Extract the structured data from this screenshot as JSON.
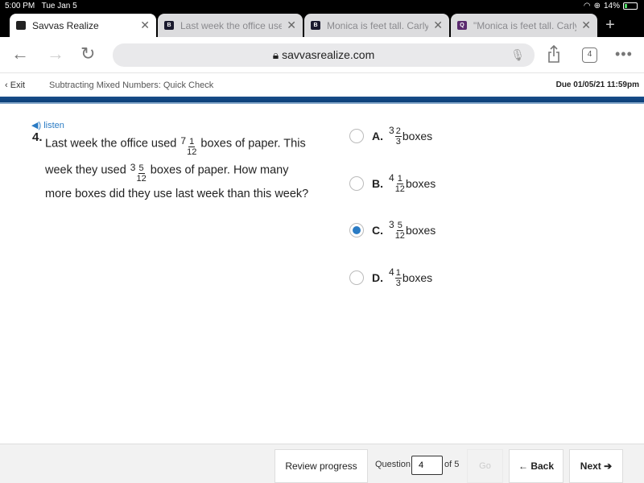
{
  "status_bar": {
    "time": "5:00 PM",
    "date": "Tue Jan 5",
    "battery": "14%"
  },
  "tabs": [
    {
      "title": "Savvas Realize",
      "icon": "savvas-favicon",
      "active": true,
      "favicon_color": "#222222"
    },
    {
      "title": "Last week the office used",
      "icon": "brainly-favicon",
      "active": false,
      "favicon_color": "#1a1a2e"
    },
    {
      "title": "Monica is feet tall. Carly is",
      "icon": "brainly-favicon",
      "active": false,
      "favicon_color": "#1a1a2e"
    },
    {
      "title": "\"Monica is feet tall. Carly",
      "icon": "quizlet-favicon",
      "active": false,
      "favicon_color": "#5a2a6e"
    }
  ],
  "toolbar": {
    "url": "savvasrealize.com",
    "tab_count": "4"
  },
  "app_header": {
    "exit_label": "Exit",
    "breadcrumb": "Subtracting Mixed Numbers: Quick Check",
    "due": "Due 01/05/21 11:59pm"
  },
  "question": {
    "listen_label": "listen",
    "number": "4",
    "text_part1": "Last week the office used",
    "mixed1": {
      "whole": "7",
      "num": "1",
      "den": "12"
    },
    "text_part2": "boxes of paper. This week they used",
    "mixed2": {
      "whole": "3",
      "num": "5",
      "den": "12"
    },
    "text_part3": "boxes of paper. How many more boxes did they use last week than this week?"
  },
  "options": [
    {
      "letter": "A.",
      "whole": "3",
      "num": "2",
      "den": "3",
      "unit": "boxes",
      "selected": false
    },
    {
      "letter": "B.",
      "whole": "4",
      "num": "1",
      "den": "12",
      "unit": "boxes",
      "selected": false
    },
    {
      "letter": "C.",
      "whole": "3",
      "num": "5",
      "den": "12",
      "unit": "boxes",
      "selected": true
    },
    {
      "letter": "D.",
      "whole": "4",
      "num": "1",
      "den": "3",
      "unit": "boxes",
      "selected": false
    }
  ],
  "footer": {
    "review_label": "Review progress",
    "question_label": "Question",
    "question_value": "4",
    "of_label": "of 5",
    "go_label": "Go",
    "back_label": "← Back",
    "next_label": "Next ➔"
  },
  "colors": {
    "accent": "#2a7bc4",
    "band": "#0b3f78"
  }
}
